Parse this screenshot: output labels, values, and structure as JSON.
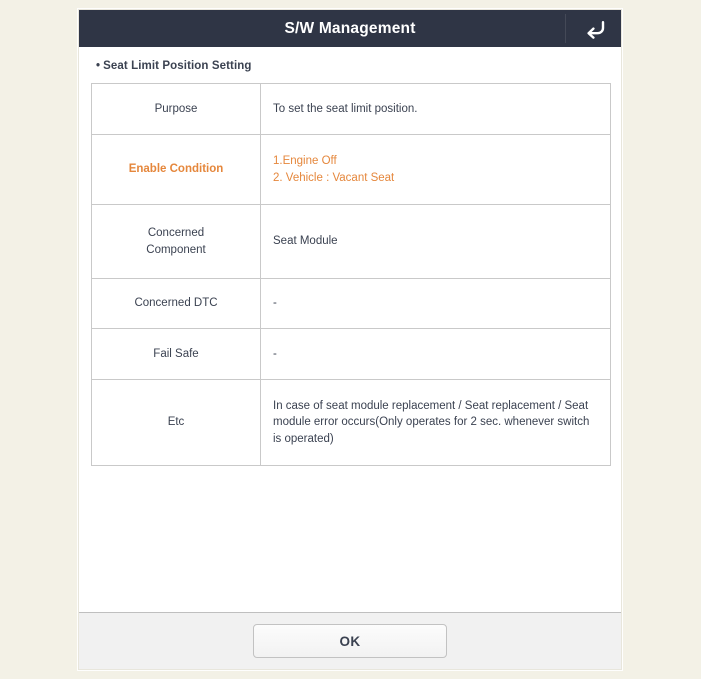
{
  "window": {
    "title": "S/W Management",
    "back_icon": "back-arrow-icon"
  },
  "content": {
    "subtitle_bullet": "•",
    "subtitle": "Seat Limit Position Setting",
    "table": {
      "rows": [
        {
          "label": "Purpose",
          "lines": [
            "To set the seat limit position."
          ],
          "accent": false
        },
        {
          "label": "Enable Condition",
          "lines": [
            "1.Engine Off",
            "2. Vehicle : Vacant Seat"
          ],
          "accent": true
        },
        {
          "label": "Concerned Component",
          "label_line1": "Concerned",
          "label_line2": "Component",
          "lines": [
            "Seat Module"
          ],
          "accent": false
        },
        {
          "label": "Concerned DTC",
          "lines": [
            "-"
          ],
          "accent": false
        },
        {
          "label": "Fail Safe",
          "lines": [
            "-"
          ],
          "accent": false
        },
        {
          "label": "Etc",
          "lines": [
            "In case of seat module replacement / Seat replacement / Seat module error occurs(Only operates for 2 sec. whenever switch is operated)"
          ],
          "accent": false
        }
      ]
    }
  },
  "footer": {
    "ok_label": "OK"
  },
  "colors": {
    "header_bg": "#2f3545",
    "accent_orange": "#e5873c",
    "text_primary": "#3b4251",
    "page_bg": "#f3f1e6",
    "footer_bg": "#f1f1f1",
    "table_border": "#c9c9c9"
  }
}
